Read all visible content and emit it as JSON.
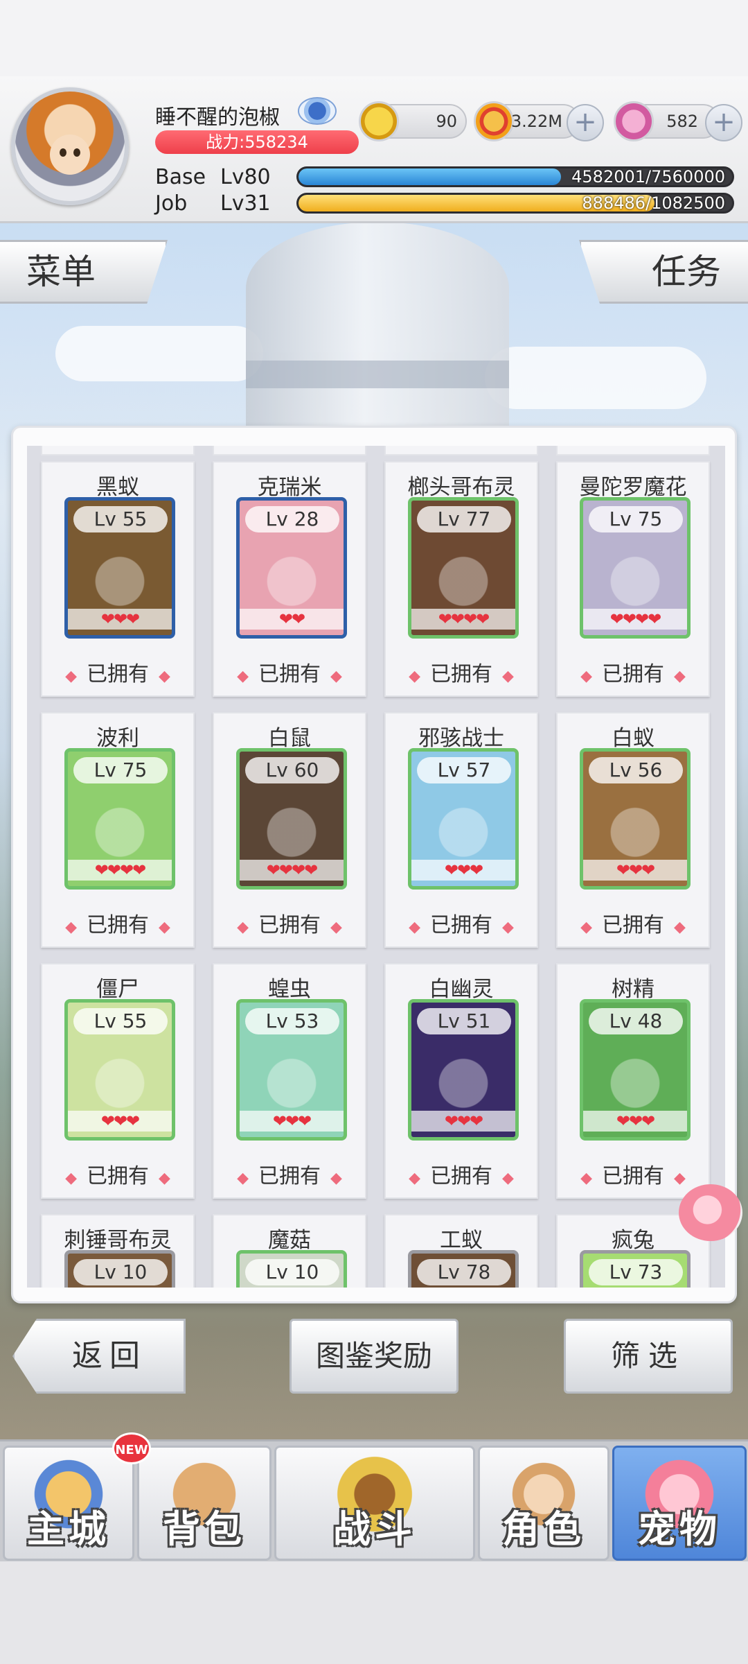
{
  "header": {
    "player_name": "睡不醒的泡椒",
    "power": "战力:558234",
    "currencies": [
      {
        "name": "zeny-icon",
        "value": "90",
        "color": "#e9b418"
      },
      {
        "name": "gold-coin-icon",
        "value": "3.22M",
        "color": "#f0a21c"
      },
      {
        "name": "gem-icon",
        "value": "582",
        "color": "#e67ab3"
      }
    ],
    "base_label": "Base",
    "base_level": "Lv80",
    "base_exp": "4582001/7560000",
    "base_progress": 0.606,
    "job_label": "Job",
    "job_level": "Lv31",
    "job_exp": "888486/1082500",
    "job_progress": 0.821
  },
  "side": {
    "menu": "菜单",
    "task": "任务"
  },
  "pets": [
    {
      "name": "黑蚁",
      "level": "Lv 55",
      "hearts": "❤❤❤",
      "status": "已拥有",
      "frame": "blue",
      "bg": "#7a5a32"
    },
    {
      "name": "克瑞米",
      "level": "Lv 28",
      "hearts": "❤❤",
      "status": "已拥有",
      "frame": "blue",
      "bg": "#e8a3b1"
    },
    {
      "name": "榔头哥布灵",
      "level": "Lv 77",
      "hearts": "❤❤❤❤",
      "status": "已拥有",
      "frame": "green",
      "bg": "#6e4a33"
    },
    {
      "name": "曼陀罗魔花",
      "level": "Lv 75",
      "hearts": "❤❤❤❤",
      "status": "已拥有",
      "frame": "green",
      "bg": "#b9b3cf"
    },
    {
      "name": "波利",
      "level": "Lv 75",
      "hearts": "❤❤❤❤",
      "status": "已拥有",
      "frame": "green",
      "bg": "#8fcf6e"
    },
    {
      "name": "白鼠",
      "level": "Lv 60",
      "hearts": "❤❤❤❤",
      "status": "已拥有",
      "frame": "green",
      "bg": "#5b4636"
    },
    {
      "name": "邪骇战士",
      "level": "Lv 57",
      "hearts": "❤❤❤",
      "status": "已拥有",
      "frame": "green",
      "bg": "#8fc9e6"
    },
    {
      "name": "白蚁",
      "level": "Lv 56",
      "hearts": "❤❤❤",
      "status": "已拥有",
      "frame": "green",
      "bg": "#9a7040"
    },
    {
      "name": "僵尸",
      "level": "Lv 55",
      "hearts": "❤❤❤",
      "status": "已拥有",
      "frame": "green",
      "bg": "#cde2a0"
    },
    {
      "name": "蝗虫",
      "level": "Lv 53",
      "hearts": "❤❤❤",
      "status": "已拥有",
      "frame": "green",
      "bg": "#8fd4b8"
    },
    {
      "name": "白幽灵",
      "level": "Lv 51",
      "hearts": "❤❤❤",
      "status": "已拥有",
      "frame": "green",
      "bg": "#3a2c68"
    },
    {
      "name": "树精",
      "level": "Lv 48",
      "hearts": "❤❤❤",
      "status": "已拥有",
      "frame": "green",
      "bg": "#5fae57"
    },
    {
      "name": "刺锤哥布灵",
      "level": "Lv 10",
      "hearts": "",
      "status": "",
      "frame": "grey",
      "bg": "#7a5a3c"
    },
    {
      "name": "魔菇",
      "level": "Lv 10",
      "hearts": "",
      "status": "",
      "frame": "green",
      "bg": "#cfd8c8"
    },
    {
      "name": "工蚁",
      "level": "Lv 78",
      "hearts": "",
      "status": "",
      "frame": "grey",
      "bg": "#6e4f36"
    },
    {
      "name": "疯兔",
      "level": "Lv 73",
      "hearts": "",
      "status": "",
      "frame": "grey",
      "bg": "#a6dc72"
    }
  ],
  "actions": {
    "back": "返回",
    "rewards": "图鉴奖励",
    "filter": "筛选"
  },
  "nav": {
    "new_badge": "NEW",
    "items": [
      {
        "label": "主城",
        "art": "#e9a24a"
      },
      {
        "label": "背包",
        "art": "#c9925a"
      },
      {
        "label": "战斗",
        "art": "#d9b34a"
      },
      {
        "label": "角色",
        "art": "#e9c7a0"
      },
      {
        "label": "宠物",
        "art": "#f6a7bb"
      }
    ]
  }
}
